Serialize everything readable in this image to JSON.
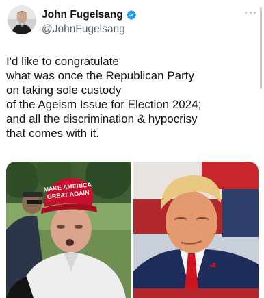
{
  "author": {
    "display_name": "John Fugelsang",
    "handle": "@JohnFugelsang",
    "verified": true
  },
  "tweet": {
    "lines": [
      "I'd like to congratulate",
      "what was once the Republican Party",
      "on taking sole custody",
      "of the Ageism Issue for Election 2024;",
      "and all the discrimination & hypocrisy",
      "that comes with it."
    ]
  },
  "media": {
    "left": {
      "cap_text_line1": "MAKE AMERICA",
      "cap_text_line2": "GREAT AGAIN"
    }
  },
  "colors": {
    "verified_blue": "#1d9bf0",
    "handle_gray": "#536471",
    "cap_red": "#c8102e"
  },
  "icons": {
    "verified": "verified-badge-icon",
    "more": "more-options-icon"
  }
}
